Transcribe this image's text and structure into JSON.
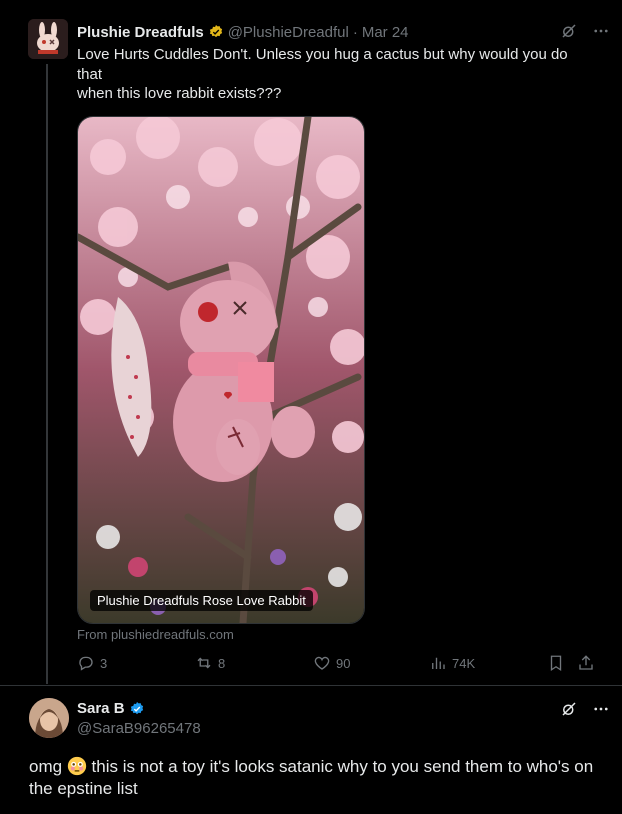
{
  "post": {
    "author_name": "Plushie Dreadfuls",
    "author_handle": "@PlushieDreadful",
    "separator": "·",
    "date": "Mar 24",
    "text_line1": "Love Hurts Cuddles Don't. Unless you hug a cactus but why would you do",
    "text_line2": "that",
    "text_line3": "when this love rabbit exists???",
    "media_caption": "Plushie Dreadfuls Rose Love Rabbit",
    "source": "From plushiedreadfuls.com",
    "icons": [
      "grok-icon",
      "more-icon",
      "verified-gold-icon"
    ]
  },
  "actions": {
    "replies": "3",
    "reposts": "8",
    "likes": "90",
    "views": "74K",
    "icons": [
      "reply-icon",
      "repost-icon",
      "like-icon",
      "views-icon",
      "bookmark-icon",
      "share-icon"
    ]
  },
  "reply": {
    "author_name": "Sara B",
    "author_handle": "@SaraB96265478",
    "text_before_emoji": "omg",
    "text_after_emoji": " this is not a toy it's looks satanic why to you send them to who's on the epstine list",
    "icons": [
      "verified-blue-icon",
      "grok-icon",
      "more-icon",
      "flushed-face-emoji"
    ]
  },
  "colors": {
    "background": "#000000",
    "text": "#e7e9ea",
    "muted": "#71767b",
    "verified_gold": "#e2b719",
    "verified_blue": "#1d9bf0"
  }
}
